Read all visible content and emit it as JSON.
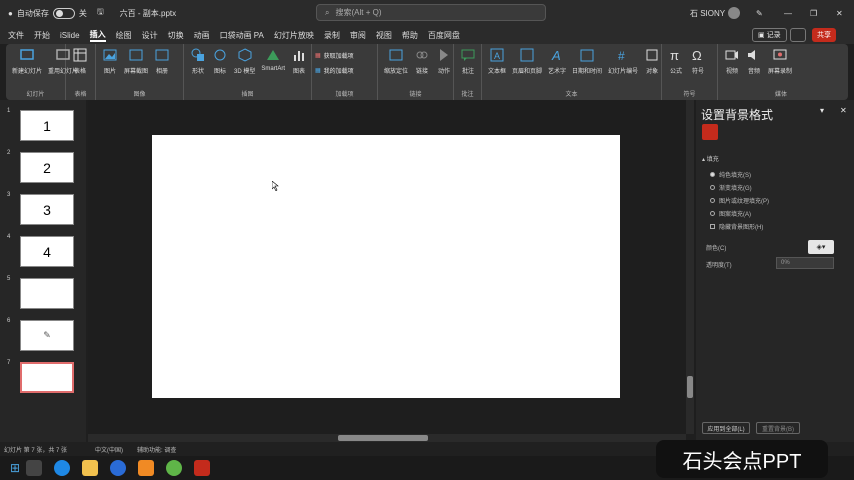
{
  "titlebar": {
    "autosave_label": "自动保存",
    "autosave_state": "关",
    "filename": "六百 - 副本.pptx",
    "search_placeholder": "搜索(Alt + Q)",
    "user_name": "石 SIONY"
  },
  "menubar": {
    "items": [
      "文件",
      "开始",
      "iSlide",
      "插入",
      "绘图",
      "设计",
      "切换",
      "动画",
      "口袋动画 PA",
      "幻灯片放映",
      "录制",
      "审阅",
      "视图",
      "帮助",
      "百度网盘"
    ],
    "active": "插入",
    "record_label": "记录",
    "share_label": "共享"
  },
  "ribbon": {
    "groups": [
      {
        "label": "幻灯片",
        "buttons": [
          "新建幻灯片",
          "重用幻灯片"
        ]
      },
      {
        "label": "表格",
        "buttons": [
          "表格"
        ]
      },
      {
        "label": "图像",
        "buttons": [
          "图片",
          "屏幕截图",
          "相册"
        ]
      },
      {
        "label": "插图",
        "buttons": [
          "形状",
          "图标",
          "3D 模型",
          "SmartArt",
          "图表"
        ]
      },
      {
        "label": "加载项",
        "buttons": [
          "获取加载项",
          "我的加载项"
        ]
      },
      {
        "label": "链接",
        "buttons": [
          "缩放定位",
          "链接",
          "动作"
        ]
      },
      {
        "label": "批注",
        "buttons": [
          "批注"
        ]
      },
      {
        "label": "文本",
        "buttons": [
          "文本框",
          "页眉和页脚",
          "艺术字",
          "日期和时间",
          "幻灯片编号",
          "对象"
        ]
      },
      {
        "label": "符号",
        "buttons": [
          "公式",
          "符号"
        ]
      },
      {
        "label": "媒体",
        "buttons": [
          "视频",
          "音频",
          "屏幕录制"
        ]
      }
    ]
  },
  "slides_panel": {
    "thumbs": [
      {
        "num": "1",
        "text": "1"
      },
      {
        "num": "2",
        "text": "2"
      },
      {
        "num": "3",
        "text": "3"
      },
      {
        "num": "4",
        "text": "4"
      },
      {
        "num": "5",
        "text": ""
      },
      {
        "num": "6",
        "text": ""
      },
      {
        "num": "7",
        "text": ""
      }
    ]
  },
  "format_pane": {
    "title": "设置背景格式",
    "section": "填充",
    "options": [
      "纯色填充(S)",
      "渐变填充(G)",
      "图片或纹理填充(P)",
      "图案填充(A)",
      "隐藏背景图形(H)"
    ],
    "color_label": "颜色(C)",
    "transparency_label": "透明度(T)",
    "transparency_value": "0%",
    "apply_all": "应用到全部(L)",
    "reset": "重置背景(B)"
  },
  "statusbar": {
    "slide_info": "幻灯片 第 7 张，共 7 张",
    "language": "中文(中国)",
    "accessibility": "辅助功能: 调查"
  },
  "watermark": {
    "text": "石头会点PPT"
  },
  "colors": {
    "accent": "#c42b1c",
    "share_bg": "#c42b1c"
  }
}
